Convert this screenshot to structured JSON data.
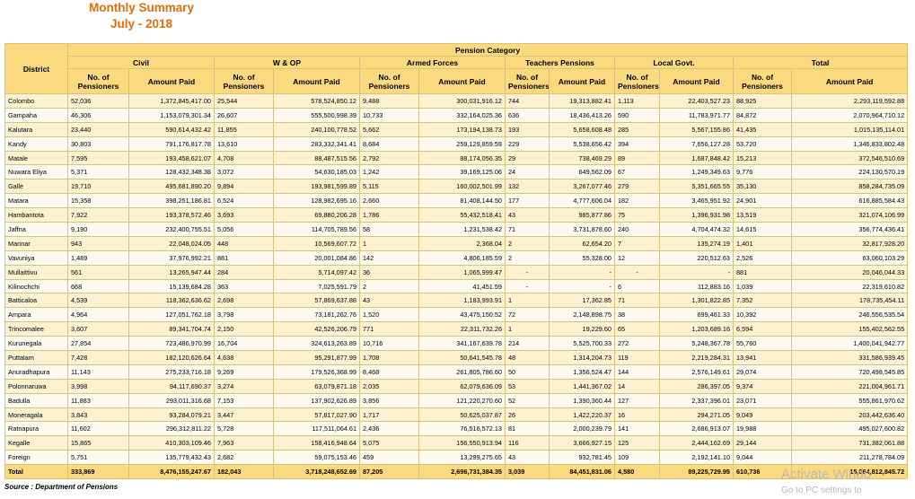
{
  "title": {
    "line1": "Monthly Summary",
    "line2": "July - 2018"
  },
  "headers": {
    "district": "District",
    "pension_category": "Pension Category",
    "categories": [
      "Civil",
      "W & OP",
      "Armed Forces",
      "Teachers Pensions",
      "Local Govt.",
      "Total"
    ],
    "no_of_pensioners": "No. of Pensioners",
    "amount_paid": "Amount Paid"
  },
  "rows": [
    [
      "Colombo",
      "52,036",
      "1,372,845,417.00",
      "25,544",
      "578,524,850.12",
      "9,488",
      "300,031,916.12",
      "744",
      "19,313,882.41",
      "1,113",
      "22,403,527.23",
      "88,925",
      "2,293,119,592.88"
    ],
    [
      "Gampaha",
      "46,306",
      "1,153,079,301.34",
      "26,607",
      "555,500,998.39",
      "10,733",
      "332,164,025.36",
      "636",
      "18,436,413.26",
      "590",
      "11,783,971.77",
      "84,872",
      "2,070,964,710.12"
    ],
    [
      "Kalutara",
      "23,440",
      "590,614,432.42",
      "11,855",
      "240,100,778.52",
      "5,662",
      "173,194,138.73",
      "193",
      "5,658,608.48",
      "285",
      "5,567,155.86",
      "41,435",
      "1,015,135,114.01"
    ],
    [
      "Kandy",
      "30,803",
      "791,176,817.78",
      "13,610",
      "283,332,341.41",
      "8,684",
      "259,129,859.59",
      "229",
      "5,538,656.42",
      "394",
      "7,656,127.28",
      "53,720",
      "1,346,833,802.48"
    ],
    [
      "Matale",
      "7,595",
      "193,458,621.07",
      "4,708",
      "88,487,515.56",
      "2,792",
      "88,174,056.35",
      "29",
      "738,469.29",
      "89",
      "1,687,848.42",
      "15,213",
      "372,546,510.69"
    ],
    [
      "Nuwara Eliya",
      "5,371",
      "128,432,348.38",
      "3,072",
      "54,630,185.03",
      "1,242",
      "39,169,125.06",
      "24",
      "649,562.09",
      "67",
      "1,249,349.63",
      "9,776",
      "224,130,570.19"
    ],
    [
      "Galle",
      "19,710",
      "495,681,890.20",
      "9,894",
      "193,981,599.89",
      "5,115",
      "160,002,501.99",
      "132",
      "3,267,077.46",
      "279",
      "5,351,665.55",
      "35,130",
      "858,284,735.09"
    ],
    [
      "Matara",
      "15,358",
      "398,251,186.81",
      "6,524",
      "128,982,695.16",
      "2,660",
      "81,408,144.50",
      "177",
      "4,777,606.04",
      "182",
      "3,465,951.92",
      "24,901",
      "616,885,584.43"
    ],
    [
      "Hambantota",
      "7,922",
      "193,378,572.46",
      "3,693",
      "69,880,206.28",
      "1,786",
      "55,432,518.41",
      "43",
      "985,877.86",
      "75",
      "1,396,931.98",
      "13,519",
      "321,074,106.99"
    ],
    [
      "Jaffna",
      "9,190",
      "232,400,755.51",
      "5,056",
      "114,705,789.56",
      "58",
      "1,231,538.42",
      "71",
      "3,731,878.60",
      "240",
      "4,704,474.32",
      "14,615",
      "356,774,436.41"
    ],
    [
      "Mannar",
      "943",
      "22,048,024.05",
      "448",
      "10,569,607.72",
      "1",
      "2,368.04",
      "2",
      "62,654.20",
      "7",
      "135,274.19",
      "1,401",
      "32,817,928.20"
    ],
    [
      "Vavuniya",
      "1,489",
      "37,976,992.21",
      "881",
      "20,001,084.86",
      "142",
      "4,806,185.59",
      "2",
      "55,328.00",
      "12",
      "220,512.63",
      "2,526",
      "63,060,103.29"
    ],
    [
      "Mullaittivu",
      "561",
      "13,265,947.44",
      "284",
      "5,714,097.42",
      "36",
      "1,065,999.47",
      "-",
      "-",
      "-",
      "-",
      "881",
      "20,046,044.33"
    ],
    [
      "Kilinochchi",
      "668",
      "15,139,684.28",
      "363",
      "7,025,591.79",
      "2",
      "41,451.59",
      "-",
      "-",
      "6",
      "112,883.16",
      "1,039",
      "22,319,610.82"
    ],
    [
      "Batticaloa",
      "4,539",
      "118,362,636.62",
      "2,698",
      "57,869,637.88",
      "43",
      "1,183,993.91",
      "1",
      "17,362.85",
      "71",
      "1,301,822.85",
      "7,352",
      "178,735,454.11"
    ],
    [
      "Ampara",
      "4,964",
      "127,051,762.18",
      "3,798",
      "73,181,262.76",
      "1,520",
      "43,475,150.52",
      "72",
      "2,148,898.75",
      "38",
      "699,461.33",
      "10,392",
      "246,556,535.54"
    ],
    [
      "Trincomalee",
      "3,607",
      "89,341,704.74",
      "2,150",
      "42,526,206.79",
      "771",
      "22,311,732.26",
      "1",
      "19,229.60",
      "65",
      "1,203,689.16",
      "6,594",
      "155,402,562.55"
    ],
    [
      "Kurunegala",
      "27,854",
      "723,486,970.99",
      "16,704",
      "324,613,263.89",
      "10,716",
      "341,167,639.78",
      "214",
      "5,525,700.33",
      "272",
      "5,248,367.78",
      "55,760",
      "1,400,041,942.77"
    ],
    [
      "Puttalam",
      "7,428",
      "182,120,626.64",
      "4,638",
      "95,291,877.99",
      "1,708",
      "50,641,545.78",
      "48",
      "1,314,204.73",
      "119",
      "2,219,284.31",
      "13,941",
      "331,586,939.45"
    ],
    [
      "Anuradhapura",
      "11,143",
      "275,233,716.18",
      "9,269",
      "179,526,368.99",
      "8,468",
      "261,805,786.60",
      "50",
      "1,356,524.47",
      "144",
      "2,576,149.61",
      "29,074",
      "720,498,545.85"
    ],
    [
      "Polonnaruwa",
      "3,998",
      "94,117,690.37",
      "3,274",
      "63,079,871.18",
      "2,035",
      "62,079,636.09",
      "53",
      "1,441,367.02",
      "14",
      "286,397.05",
      "9,374",
      "221,004,961.71"
    ],
    [
      "Badulla",
      "11,883",
      "293,011,316.68",
      "7,153",
      "137,902,626.89",
      "3,856",
      "121,220,270.60",
      "52",
      "1,390,360.44",
      "127",
      "2,337,396.01",
      "23,071",
      "555,861,970.62"
    ],
    [
      "Moneragala",
      "3,843",
      "93,284,079.21",
      "3,447",
      "57,817,027.90",
      "1,717",
      "50,625,037.87",
      "26",
      "1,422,220.37",
      "16",
      "294,271.05",
      "9,049",
      "203,442,636.40"
    ],
    [
      "Ratnapura",
      "11,602",
      "296,312,811.22",
      "5,728",
      "117,511,064.61",
      "2,436",
      "76,516,572.13",
      "81",
      "2,000,239.79",
      "141",
      "2,686,913.07",
      "19,988",
      "495,027,600.82"
    ],
    [
      "Kegalle",
      "15,865",
      "410,303,109.46",
      "7,963",
      "158,416,948.64",
      "5,075",
      "156,550,913.94",
      "116",
      "3,666,927.15",
      "125",
      "2,444,162.69",
      "29,144",
      "731,382,061.88"
    ],
    [
      "Foreign",
      "5,751",
      "135,779,432.43",
      "2,682",
      "59,075,153.46",
      "459",
      "13,299,275.65",
      "43",
      "932,781.45",
      "109",
      "2,192,141.10",
      "9,044",
      "211,278,784.09"
    ]
  ],
  "total": [
    "Total",
    "333,869",
    "8,476,155,247.67",
    "182,043",
    "3,718,248,652.69",
    "87,205",
    "2,696,731,384.35",
    "3,039",
    "84,451,831.06",
    "4,580",
    "89,225,729.95",
    "610,736",
    "15,064,812,845.72"
  ],
  "source": "Source : Department of Pensions",
  "watermark": {
    "line1": "Activate Windo",
    "line2": "Go to PC settings to"
  }
}
